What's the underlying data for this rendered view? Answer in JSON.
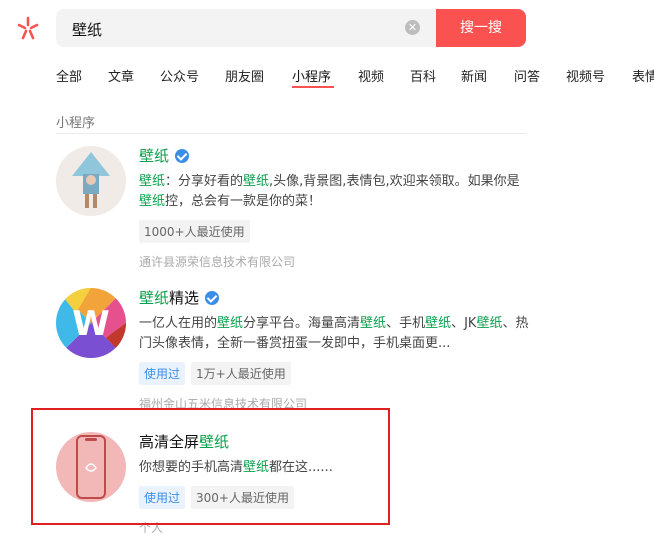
{
  "search": {
    "query": "壁纸",
    "button_label": "搜一搜"
  },
  "tabs": [
    "全部",
    "文章",
    "公众号",
    "朋友圈",
    "小程序",
    "视频",
    "百科",
    "新闻",
    "问答",
    "视频号",
    "表情"
  ],
  "active_tab": "小程序",
  "section_title": "小程序",
  "results": [
    {
      "title_hl": "壁纸",
      "title_rest": "",
      "verified": true,
      "desc_parts": [
        {
          "t": "壁纸",
          "hl": true
        },
        {
          "t": "：分享好看的",
          "hl": false
        },
        {
          "t": "壁纸",
          "hl": true
        },
        {
          "t": ",头像,背景图,表情包,欢迎来领取。如果你是",
          "hl": false
        },
        {
          "t": "壁纸",
          "hl": true
        },
        {
          "t": "控，总会有一款是你的菜！",
          "hl": false
        }
      ],
      "tags": [
        {
          "label": "1000+人最近使用",
          "used": false
        }
      ],
      "company": "通许县源荣信息技术有限公司"
    },
    {
      "title_hl": "壁纸",
      "title_rest": "精选",
      "verified": true,
      "desc_parts": [
        {
          "t": "一亿人在用的",
          "hl": false
        },
        {
          "t": "壁纸",
          "hl": true
        },
        {
          "t": "分享平台。海量高清",
          "hl": false
        },
        {
          "t": "壁纸",
          "hl": true
        },
        {
          "t": "、手机",
          "hl": false
        },
        {
          "t": "壁纸",
          "hl": true
        },
        {
          "t": "、JK",
          "hl": false
        },
        {
          "t": "壁纸",
          "hl": true
        },
        {
          "t": "、热门头像表情，全新一番赏扭蛋一发即中，手机桌面更...",
          "hl": false
        }
      ],
      "tags": [
        {
          "label": "使用过",
          "used": true
        },
        {
          "label": "1万+人最近使用",
          "used": false
        }
      ],
      "company": "福州金山五米信息技术有限公司"
    },
    {
      "title_hl": "壁纸",
      "title_prefix": "高清全屏",
      "verified": false,
      "desc_parts": [
        {
          "t": "你想要的手机高清",
          "hl": false
        },
        {
          "t": "壁纸",
          "hl": true
        },
        {
          "t": "都在这......",
          "hl": false
        }
      ],
      "tags": [
        {
          "label": "使用过",
          "used": true
        },
        {
          "label": "300+人最近使用",
          "used": false
        }
      ],
      "company": "个人"
    }
  ],
  "colors": {
    "accent": "#fa5151",
    "highlight": "#07a14b",
    "verified": "#3a8ee6",
    "annotation_box": "#e02020"
  }
}
